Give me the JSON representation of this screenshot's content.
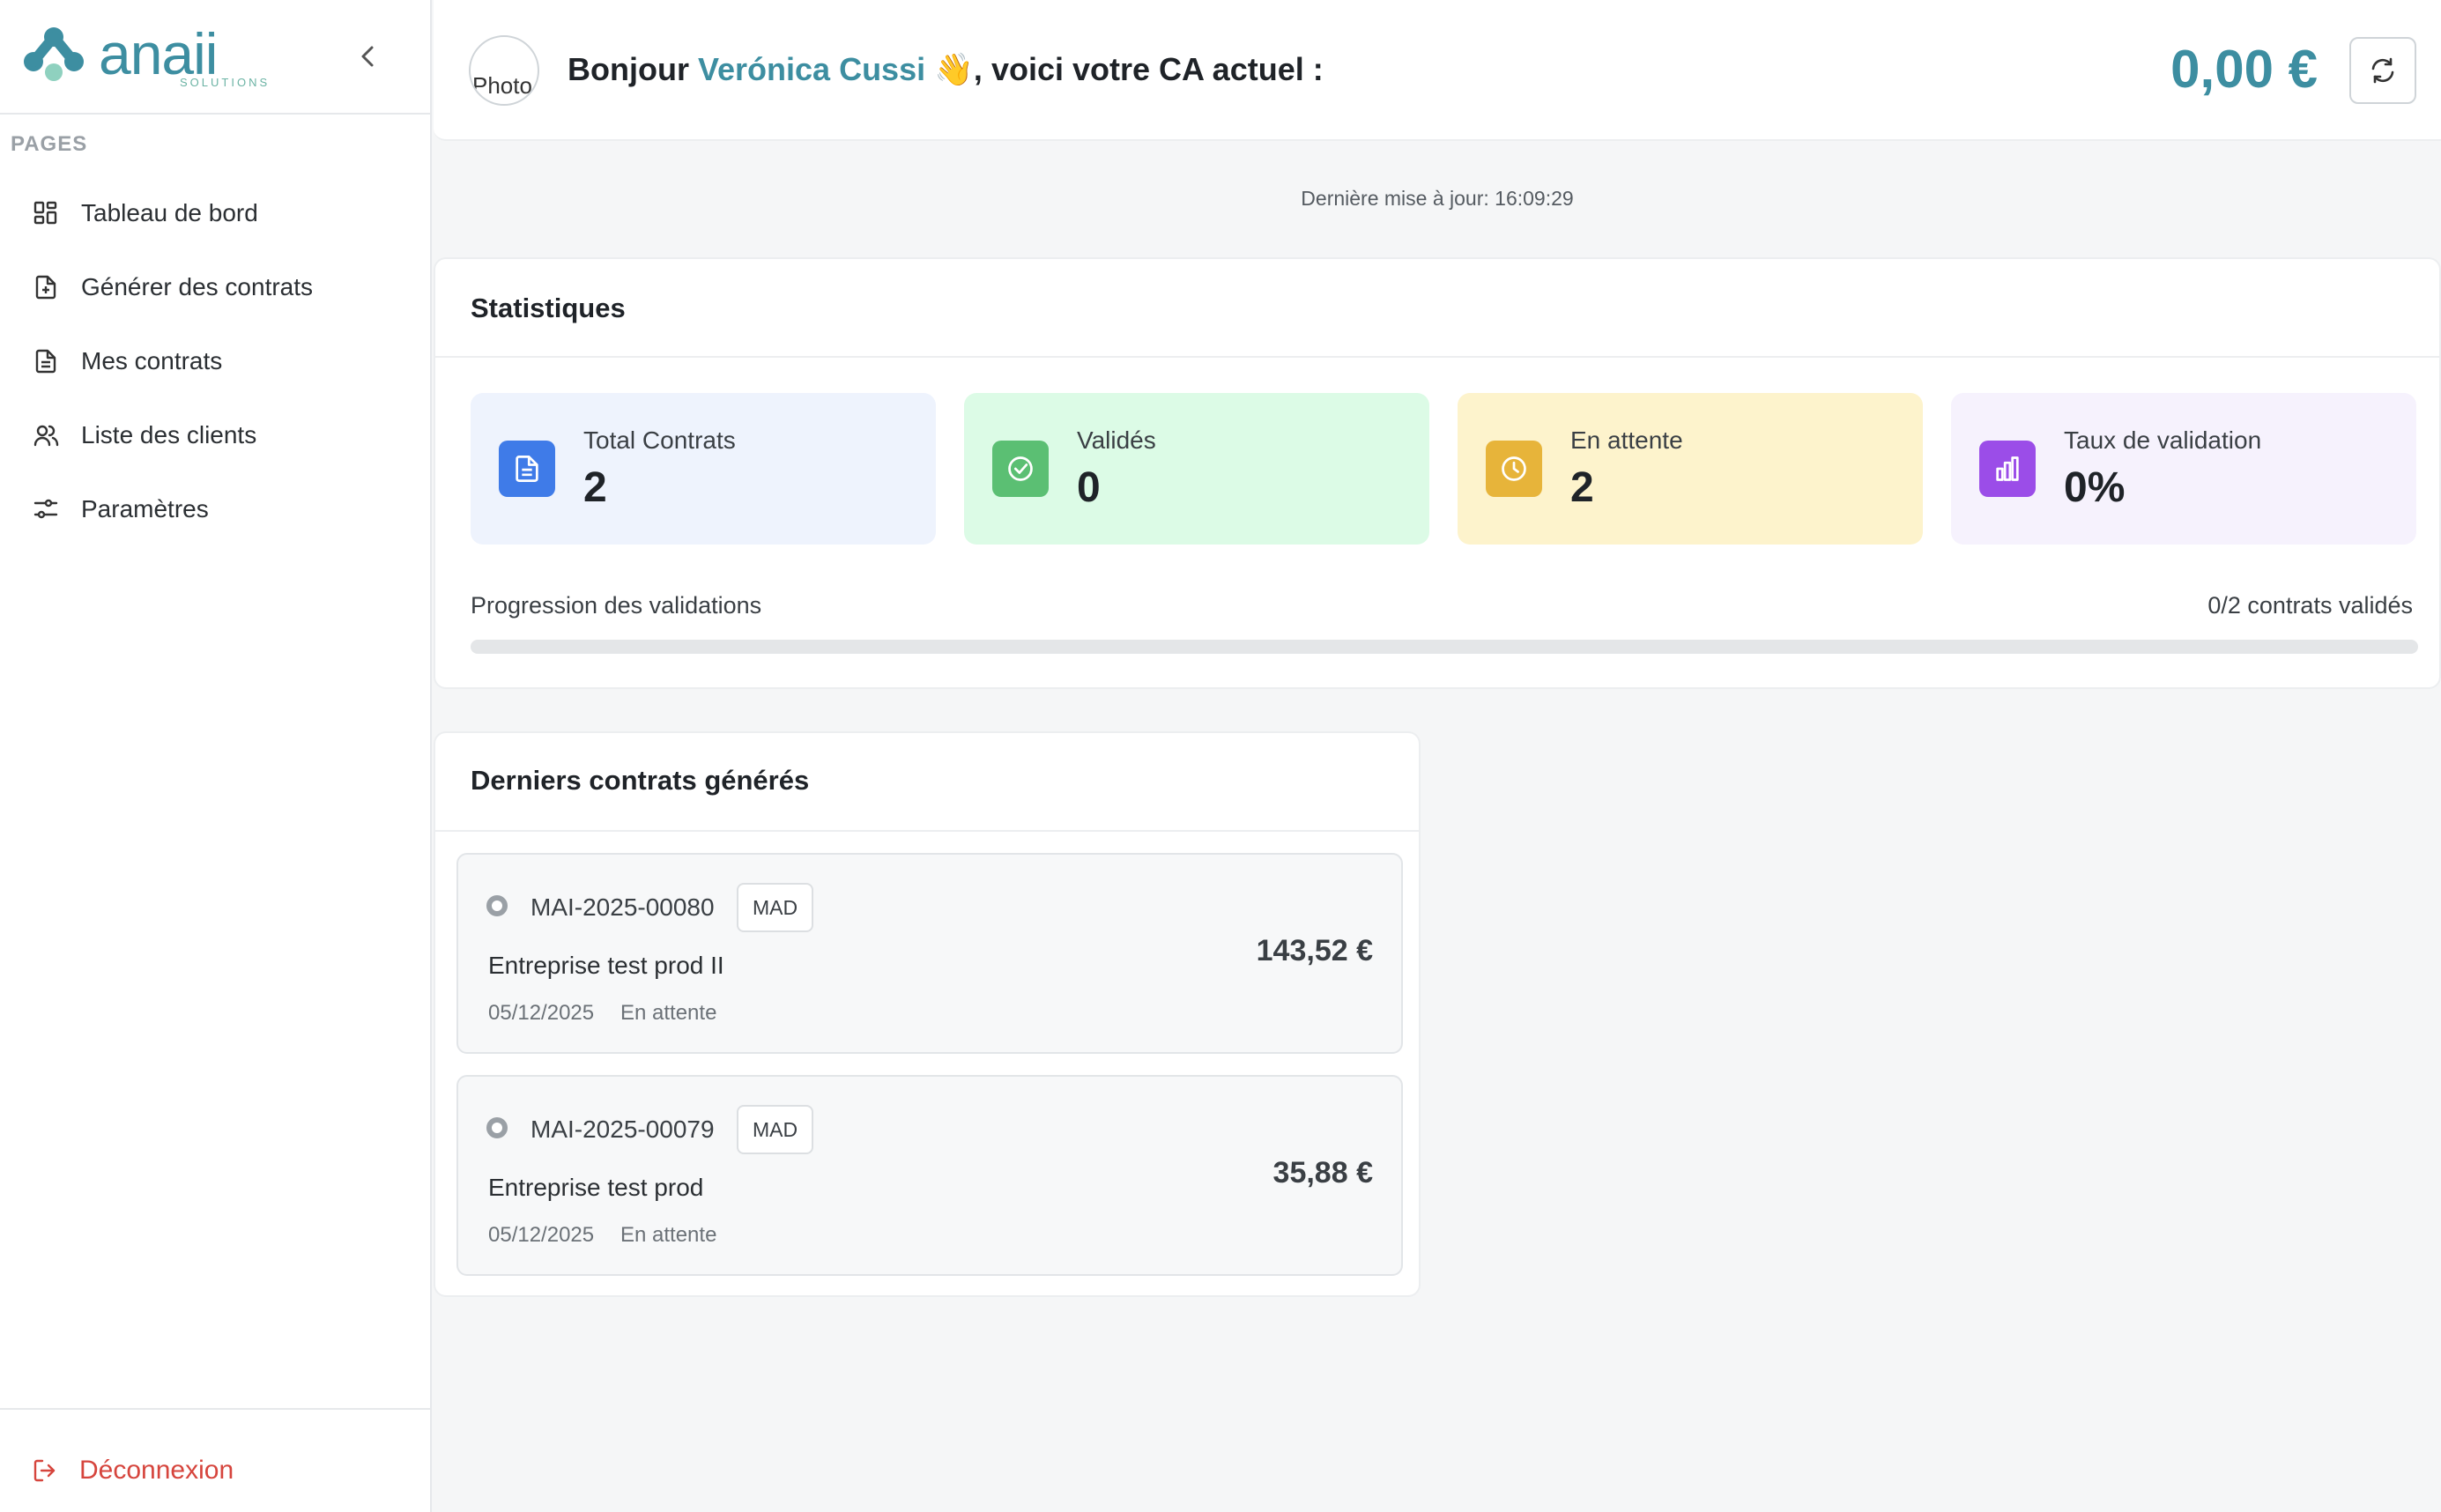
{
  "brand": {
    "name": "anaii",
    "sub": "SOLUTIONS"
  },
  "sidebar": {
    "section_label": "PAGES",
    "items": [
      {
        "label": "Tableau de bord",
        "icon": "dashboard-icon"
      },
      {
        "label": "Générer des contrats",
        "icon": "file-plus-icon"
      },
      {
        "label": "Mes contrats",
        "icon": "file-text-icon"
      },
      {
        "label": "Liste des clients",
        "icon": "users-icon"
      },
      {
        "label": "Paramètres",
        "icon": "settings-sliders-icon"
      }
    ],
    "logout": "Déconnexion"
  },
  "header": {
    "avatar_alt": "Photo",
    "greeting_prefix": "Bonjour ",
    "user_name": "Verónica Cussi",
    "greeting_suffix": " 👋, voici votre CA actuel :",
    "ca_amount": "0,00 €"
  },
  "last_update": "Dernière mise à jour: 16:09:29",
  "stats": {
    "title": "Statistiques",
    "cards": [
      {
        "label": "Total Contrats",
        "value": "2",
        "bg": "#eef3fd",
        "icon_bg": "#3f7be8",
        "icon": "document-icon"
      },
      {
        "label": "Validés",
        "value": "0",
        "bg": "#dcfbe6",
        "icon_bg": "#5bbf73",
        "icon": "check-circle-icon"
      },
      {
        "label": "En attente",
        "value": "2",
        "bg": "#fdf3cc",
        "icon_bg": "#e7b43a",
        "icon": "clock-icon"
      },
      {
        "label": "Taux de validation",
        "value": "0%",
        "bg": "#f6f2fd",
        "icon_bg": "#9b4de8",
        "icon": "bar-chart-icon"
      }
    ],
    "progress_label": "Progression des validations",
    "progress_count": "0/2 contrats validés",
    "progress_fraction": 0
  },
  "contracts": {
    "title": "Derniers contrats générés",
    "items": [
      {
        "ref": "MAI-2025-00080",
        "tag": "MAD",
        "client": "Entreprise test prod II",
        "date": "05/12/2025",
        "status": "En attente",
        "amount": "143,52 €"
      },
      {
        "ref": "MAI-2025-00079",
        "tag": "MAD",
        "client": "Entreprise test prod",
        "date": "05/12/2025",
        "status": "En attente",
        "amount": "35,88 €"
      }
    ]
  }
}
